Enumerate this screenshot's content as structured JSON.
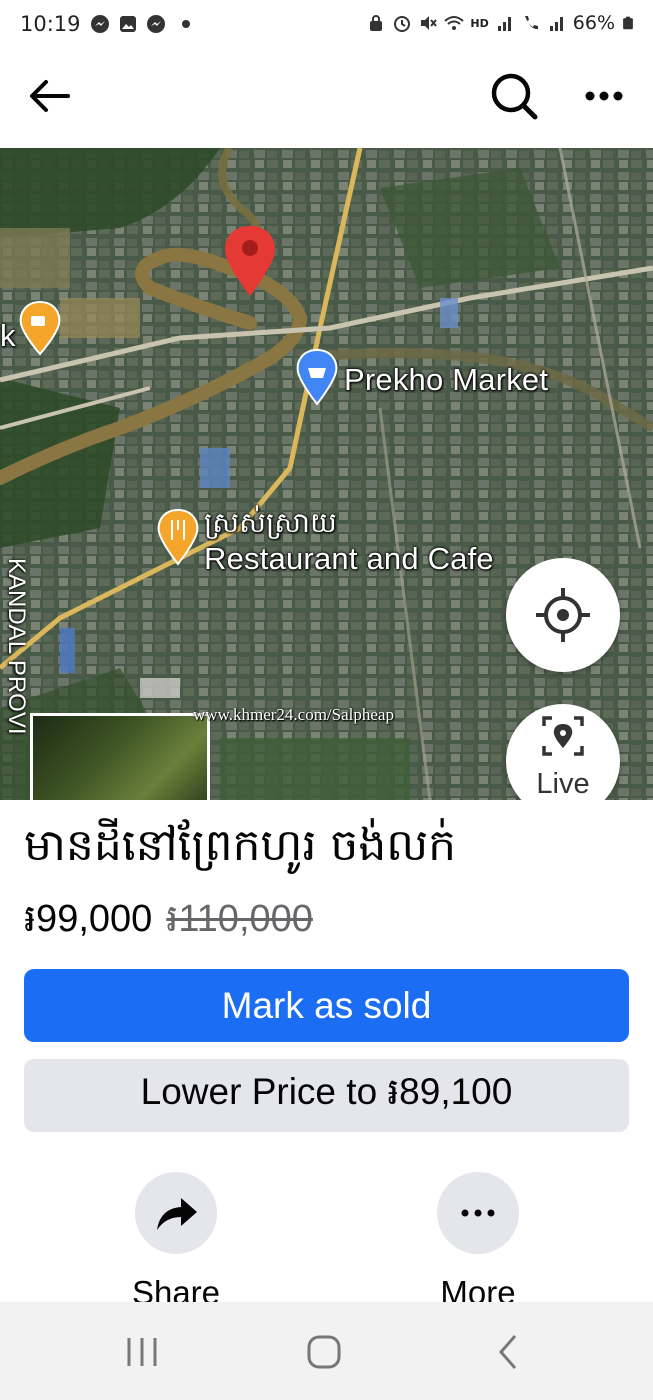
{
  "status_bar": {
    "time": "10:19",
    "battery": "66%",
    "network_badge": "HD",
    "left_icons": [
      "messenger-icon",
      "gallery-icon",
      "messenger-icon",
      "dot-icon"
    ],
    "right_icons": [
      "lock-icon",
      "alarm-icon",
      "mute-icon",
      "wifi-icon",
      "signal-icon",
      "wifi-calling-icon",
      "signal-icon",
      "battery-icon"
    ]
  },
  "app_bar": {
    "icons": [
      "back-arrow-icon",
      "search-icon",
      "more-dots-icon"
    ]
  },
  "map": {
    "labels": {
      "market": "Prekho Market",
      "restaurant_khmer": "ស្រស់ស្រាយ",
      "restaurant": "Restaurant and Cafe",
      "edge_letter": "k",
      "province": "KANDAL PROVI"
    },
    "watermark": "www.khmer24.com/Salpheap",
    "live_label": "Live",
    "colors": {
      "pin": "#e53935",
      "market_pin": "#4285f4",
      "food_pin": "#f4a52a",
      "river": "#8a7642",
      "road": "#d9b75a"
    }
  },
  "listing": {
    "title": "មានដីនៅព្រែកហូរ ចង់លក់",
    "price": "៛99,000",
    "original_price": "៛110,000"
  },
  "buttons": {
    "mark_sold": "Mark as sold",
    "lower_price": "Lower Price to ៛89,100",
    "accent_color": "#1b6ef3"
  },
  "actions": {
    "share": "Share",
    "more": "More"
  },
  "nav_bar": {
    "icons": [
      "recent-apps-icon",
      "home-icon",
      "back-icon"
    ]
  }
}
